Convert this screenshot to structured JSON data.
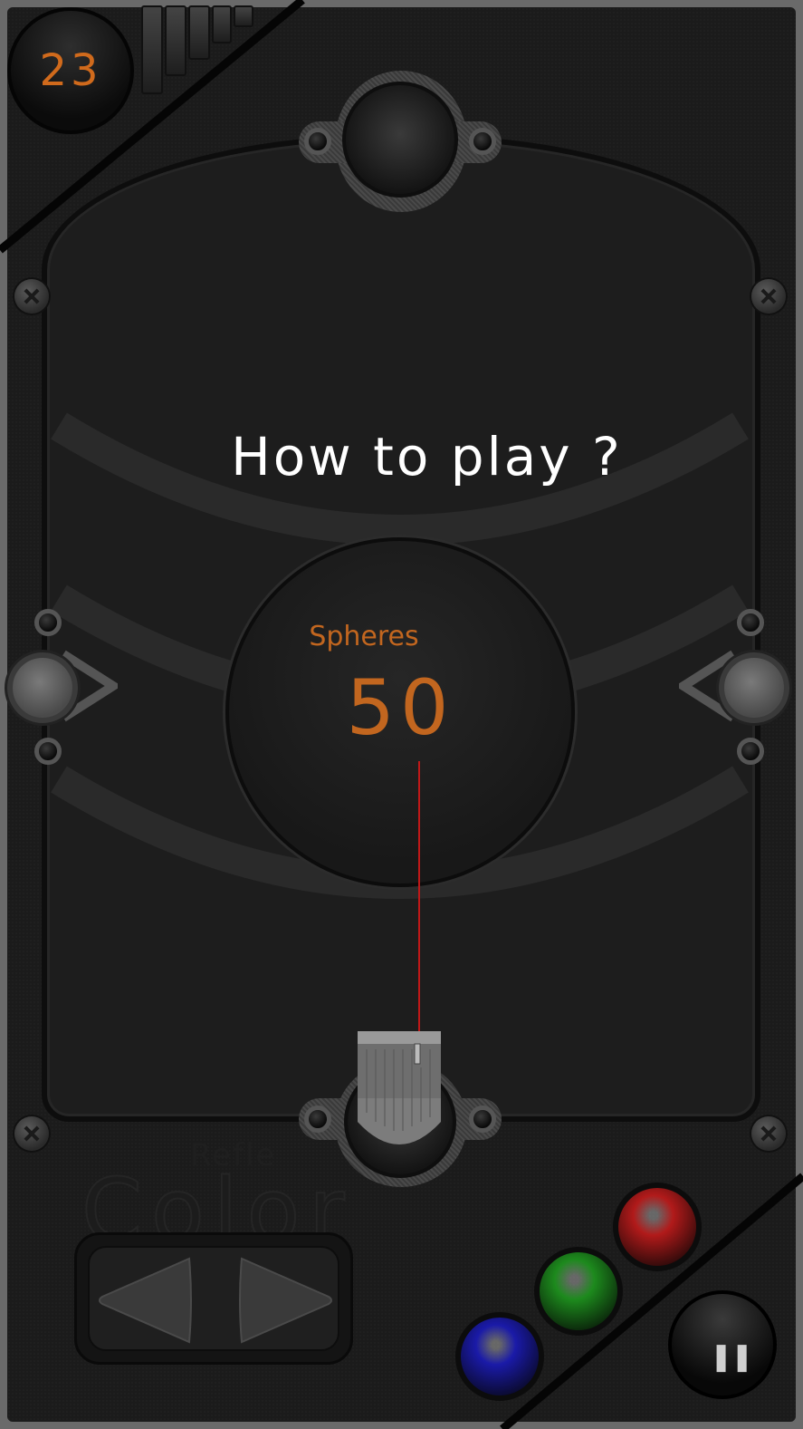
{
  "hud": {
    "score": "23",
    "level_bars": 5
  },
  "overlay": {
    "title": "How to play ?"
  },
  "dial": {
    "label": "Spheres",
    "value": "50"
  },
  "controls": {
    "left_icon": "left-arrow-icon",
    "right_icon": "right-arrow-icon",
    "pause_icon": "pause-icon",
    "pause_glyph": "❚❚"
  },
  "spheres": [
    {
      "color_name": "red",
      "color": "#b11a1a"
    },
    {
      "color_name": "green",
      "color": "#1d8a1d"
    },
    {
      "color_name": "blue",
      "color": "#1a1aa8"
    }
  ],
  "colors": {
    "accent_orange": "#c2661f",
    "background": "#1b1b1b",
    "laser": "#c01818"
  }
}
